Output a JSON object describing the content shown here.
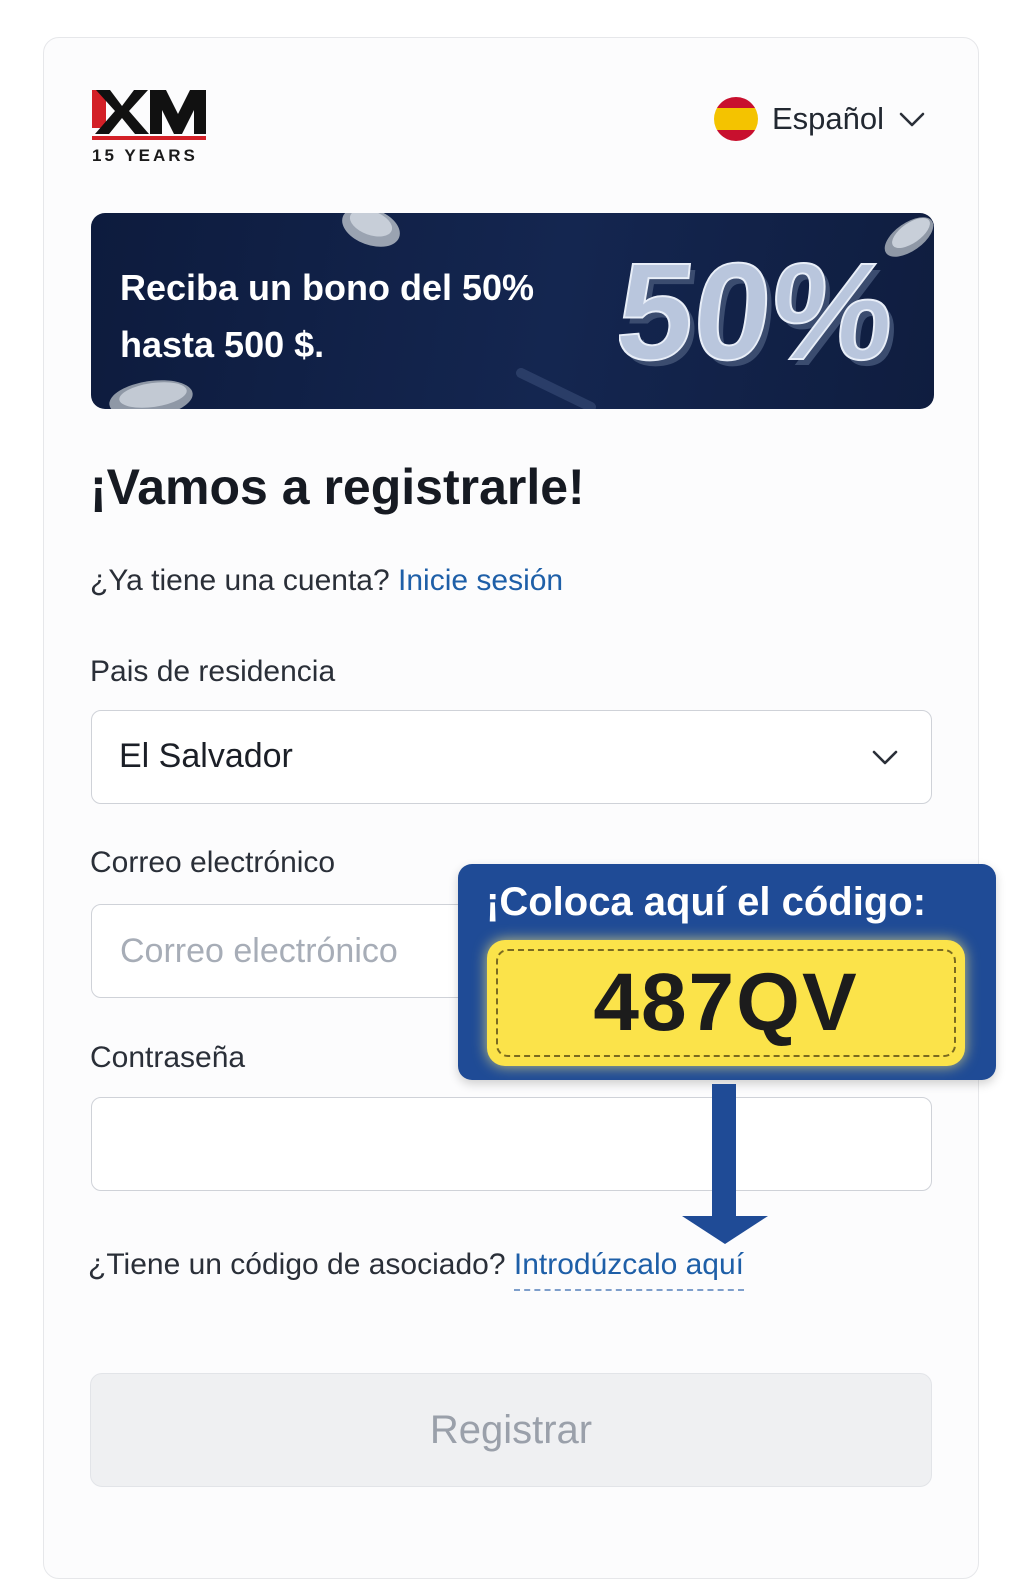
{
  "logo": {
    "brand": "XM",
    "tagline": "15 YEARS"
  },
  "language": {
    "label": "Español",
    "flag_icon": "spain-flag-icon"
  },
  "banner": {
    "line1": "Reciba un bono del 50%",
    "line2": "hasta 500 $.",
    "graphic_text": "50%"
  },
  "form": {
    "title": "¡Vamos a registrarle!",
    "login_prompt": "¿Ya tiene una cuenta?",
    "login_link": "Inicie sesión",
    "country": {
      "label": "Pais de residencia",
      "value": "El Salvador"
    },
    "email": {
      "label": "Correo electrónico",
      "placeholder": "Correo electrónico"
    },
    "password": {
      "label": "Contraseña",
      "placeholder": ""
    },
    "affiliate_prompt": "¿Tiene un código de asociado?",
    "affiliate_link": "Introdúzcalo aquí",
    "submit_label": "Registrar"
  },
  "promo": {
    "title": "¡Coloca aquí el código:",
    "code": "487QV"
  },
  "colors": {
    "link": "#1e5fa8",
    "brand_red": "#d32027",
    "promo_blue": "#1f4b96",
    "promo_yellow": "#fbe34a",
    "banner_navy": "#0f1d3f"
  }
}
